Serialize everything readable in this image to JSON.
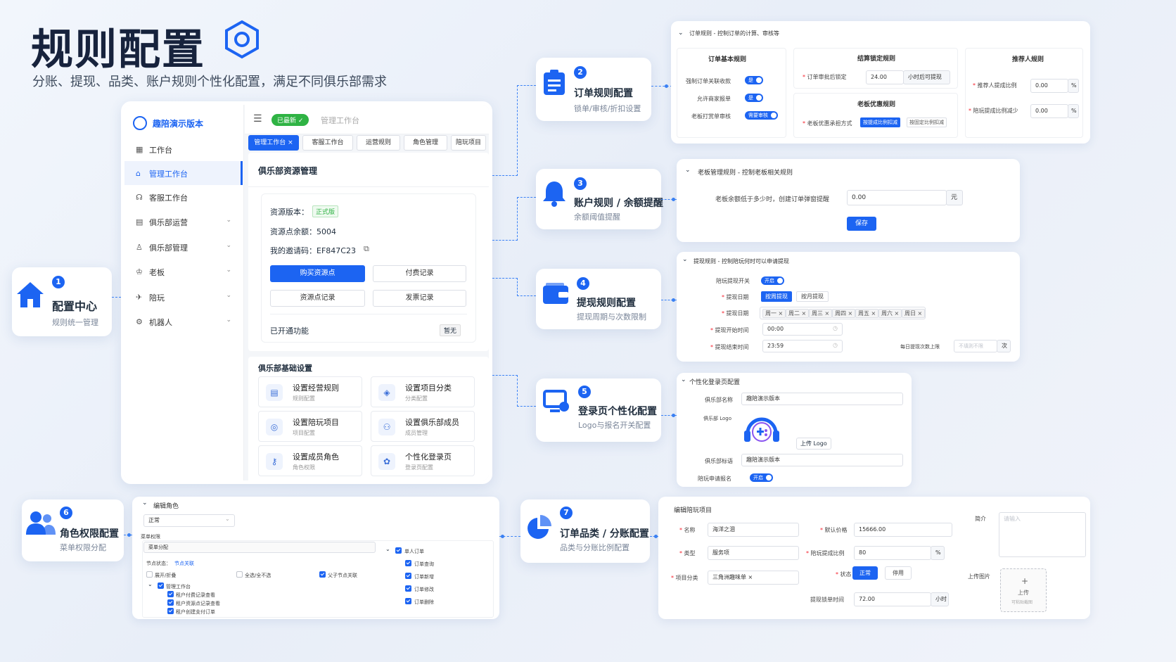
{
  "hero": {
    "title": "规则配置",
    "subtitle": "分账、提现、品类、账户规则个性化配置，满足不同俱乐部需求"
  },
  "center": {
    "num": "1",
    "title": "配置中心",
    "sub": "规则统一管理"
  },
  "features": [
    {
      "num": "2",
      "title": "订单规则配置",
      "sub": "锁单/审核/折扣设置"
    },
    {
      "num": "3",
      "title": "账户规则 / 余额提醒",
      "sub": "余额阈值提醒"
    },
    {
      "num": "4",
      "title": "提现规则配置",
      "sub": "提现周期与次数限制"
    },
    {
      "num": "5",
      "title": "登录页个性化配置",
      "sub": "Logo与报名开关配置"
    },
    {
      "num": "6",
      "title": "角色权限配置",
      "sub": "菜单权限分配"
    },
    {
      "num": "7",
      "title": "订单品类 / 分账配置",
      "sub": "品类与分账比例配置"
    }
  ],
  "app": {
    "brand": "趣陪演示版本",
    "latest_badge": "已最新 ✓",
    "breadcrumb": "管理工作台",
    "sidebar": [
      "工作台",
      "管理工作台",
      "客服工作台",
      "俱乐部运营",
      "俱乐部管理",
      "老板",
      "陪玩",
      "机器人"
    ],
    "tabs": [
      "管理工作台 ×",
      "客服工作台",
      "运营规则",
      "角色管理",
      "陪玩项目"
    ],
    "resource": {
      "title": "俱乐部资源管理",
      "version_label": "资源版本：",
      "version_value": "正式版",
      "balance": "资源点余额：5004",
      "invite": "我的邀请码：EF847C23",
      "buy": "购买资源点",
      "pay_record": "付费记录",
      "res_record": "资源点记录",
      "invoice": "发票记录",
      "opened": "已开通功能",
      "opened_value": "暂无"
    },
    "basic": {
      "title": "俱乐部基础设置",
      "tiles": [
        {
          "title": "设置经营规则",
          "sub": "规则配置"
        },
        {
          "title": "设置项目分类",
          "sub": "分类配置"
        },
        {
          "title": "设置陪玩项目",
          "sub": "项目配置"
        },
        {
          "title": "设置俱乐部成员",
          "sub": "成员管理"
        },
        {
          "title": "设置成员角色",
          "sub": "角色权限"
        },
        {
          "title": "个性化登录页",
          "sub": "登录页配置"
        }
      ]
    }
  },
  "order_panel": {
    "header": "订单规则 - 控制订单的计算、审核等",
    "basic_title": "订单基本规则",
    "basic_rows": [
      {
        "label": "强制订单关联收款",
        "toggle": "是"
      },
      {
        "label": "允许商家报单",
        "toggle": "是"
      },
      {
        "label": "老板打赏单审核",
        "toggle": "需要审核"
      }
    ],
    "lock_title": "结算锁定规则",
    "lock_label": "订单审批后锁定",
    "lock_value": "24.00",
    "lock_unit": "小时后可提现",
    "boss_title": "老板优惠规则",
    "boss_label": "老板优惠承担方式",
    "boss_opt1": "按提成比例扣减",
    "boss_opt2": "按固定比例扣减",
    "ref_title": "推荐人规则",
    "ref_rows": [
      {
        "label": "推荐人提成比例",
        "value": "0.00",
        "unit": "%"
      },
      {
        "label": "陪玩提成比例减少",
        "value": "0.00",
        "unit": "%"
      }
    ]
  },
  "boss_panel": {
    "header": "老板管理规则 - 控制老板相关规则",
    "label": "老板余额低于多少时，创建订单弹窗提醒",
    "value": "0.00",
    "unit": "元",
    "save": "保存"
  },
  "withdraw_panel": {
    "header": "提现规则 - 控制陪玩何时可以申请提现",
    "switch_label": "陪玩提现开关",
    "switch_value": "开启",
    "date_label": "提现日期",
    "date_opt1": "按周提现",
    "date_opt2": "按月提现",
    "weekday_label": "提现日期",
    "weekdays": [
      "周一 ×",
      "周二 ×",
      "周三 ×",
      "周四 ×",
      "周五 ×",
      "周六 ×",
      "周日 ×"
    ],
    "start_label": "提现开始时间",
    "start_value": "00:00",
    "end_label": "提现结束时间",
    "end_value": "23:59",
    "limit_label": "每日提现次数上限",
    "limit_placeholder": "不填则不限",
    "limit_unit": "次"
  },
  "login_panel": {
    "header": "个性化登录页配置",
    "name_label": "俱乐部名称",
    "name_value": "趣陪演示版本",
    "logo_label": "俱乐部 Logo",
    "upload": "上传 Logo",
    "slogan_label": "俱乐部标语",
    "slogan_value": "趣陪演示版本",
    "apply_label": "陪玩申请报名",
    "apply_value": "开启"
  },
  "role_panel": {
    "header": "编辑角色",
    "status": "正常",
    "perm_label": "菜单权限",
    "menu_assign": "菜单分配",
    "node_state": "节点状态：",
    "node_link": "节点关联",
    "expand": "展开/折叠",
    "select_all": "全选/全不选",
    "parent_link": "父子节点关联",
    "tree_left": [
      "管理工作台",
      "租户付费记录查看",
      "租户资源点记录查看",
      "租户创建支付订单"
    ],
    "tree_right": [
      "单人订单",
      "订单查询",
      "订单新增",
      "订单修改",
      "订单删除"
    ]
  },
  "item_panel": {
    "header": "编辑陪玩项目",
    "name_label": "名称",
    "name_value": "海洋之泪",
    "price_label": "默认价格",
    "price_value": "15666.00",
    "type_label": "类型",
    "type_value": "服务项",
    "ratio_label": "陪玩提成比例",
    "ratio_value": "80",
    "ratio_unit": "%",
    "cat_label": "项目分类",
    "cat_value": "三角洲趣味单 ×",
    "status_label": "状态",
    "status_on": "正常",
    "status_off": "停用",
    "lock_label": "提现锁单时间",
    "lock_value": "72.00",
    "lock_unit": "小时",
    "intro_label": "简介",
    "intro_placeholder": "请输入",
    "upload_label": "上传图片",
    "upload_text": "上传",
    "upload_hint": "可粘贴截图"
  },
  "colors": {
    "accent": "#1c64f2",
    "green": "#2fb344"
  }
}
